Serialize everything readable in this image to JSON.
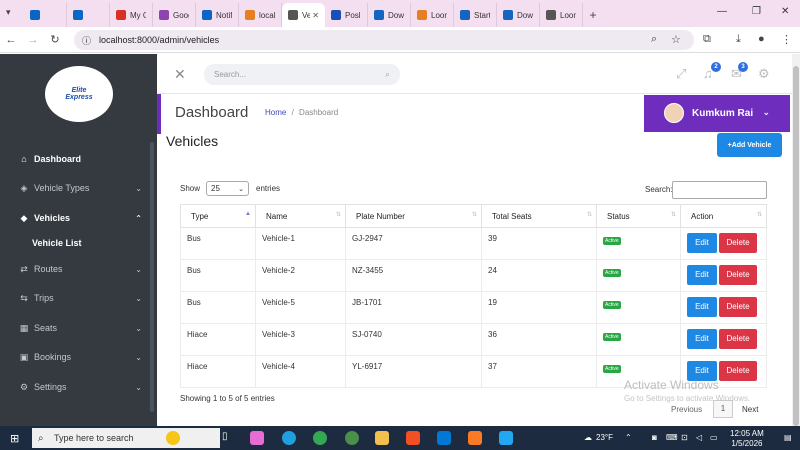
{
  "browser": {
    "tabs": [
      {
        "label": "",
        "color": "#0a66c2"
      },
      {
        "label": "",
        "color": "#0a66c2"
      },
      {
        "label": "My Ch",
        "color": "#d93025"
      },
      {
        "label": "Googl",
        "color": "#8e44ad"
      },
      {
        "label": "Notifi",
        "color": "#0a66c2"
      },
      {
        "label": "localh",
        "color": "#e67e22"
      },
      {
        "label": "Ve",
        "color": "#555555",
        "active": true
      },
      {
        "label": "Posla",
        "color": "#1a4fb5"
      },
      {
        "label": "Down",
        "color": "#1565c0"
      },
      {
        "label": "Loom",
        "color": "#e67e22"
      },
      {
        "label": "Start U",
        "color": "#1565c0"
      },
      {
        "label": "Down",
        "color": "#1565c0"
      },
      {
        "label": "Loom",
        "color": "#555555"
      }
    ],
    "url": "localhost:8000/admin/vehicles"
  },
  "sidebar": {
    "logo": {
      "line1": "Elite",
      "line2": "Express"
    },
    "items": [
      {
        "label": "Dashboard",
        "icon": "home-icon"
      },
      {
        "label": "Vehicle Types",
        "icon": "tag-icon"
      },
      {
        "label": "Vehicles",
        "icon": "tags-icon"
      },
      {
        "label": "Routes",
        "icon": "route-icon"
      },
      {
        "label": "Trips",
        "icon": "trip-icon"
      },
      {
        "label": "Seats",
        "icon": "grid-icon"
      },
      {
        "label": "Bookings",
        "icon": "booking-icon"
      },
      {
        "label": "Settings",
        "icon": "gear-icon"
      }
    ],
    "subitem": "Vehicle List"
  },
  "header": {
    "search_placeholder": "Search...",
    "notifications_count": "2",
    "messages_count": "3"
  },
  "pagehead": {
    "title": "Dashboard",
    "crumb_home": "Home",
    "crumb_sep": "/",
    "crumb_current": "Dashboard"
  },
  "user": {
    "name": "Kumkum Rai"
  },
  "content": {
    "title": "Vehicles",
    "add_button": "+Add Vehicle",
    "show_label": "Show",
    "page_size": "25",
    "entries_label": "entries",
    "search_label": "Search:",
    "columns": [
      "Type",
      "Name",
      "Plate Number",
      "Total Seats",
      "Status",
      "Action"
    ],
    "rows": [
      {
        "type": "Bus",
        "name": "Vehicle-1",
        "plate": "GJ-2947",
        "seats": "39",
        "status": "Active"
      },
      {
        "type": "Bus",
        "name": "Vehicle-2",
        "plate": "NZ-3455",
        "seats": "24",
        "status": "Active"
      },
      {
        "type": "Bus",
        "name": "Vehicle-5",
        "plate": "JB-1701",
        "seats": "19",
        "status": "Active"
      },
      {
        "type": "Hiace",
        "name": "Vehicle-3",
        "plate": "SJ-0740",
        "seats": "36",
        "status": "Active"
      },
      {
        "type": "Hiace",
        "name": "Vehicle-4",
        "plate": "YL-6917",
        "seats": "37",
        "status": "Active"
      }
    ],
    "edit_label": "Edit",
    "delete_label": "Delete",
    "info": "Showing 1 to 5 of 5 entries",
    "prev": "Previous",
    "page": "1",
    "next": "Next"
  },
  "watermark": {
    "line1": "Activate Windows",
    "line2": "Go to Settings to activate Windows."
  },
  "taskbar": {
    "search_placeholder": "Type here to search",
    "weather": "23°F",
    "time": "12:05 AM",
    "date": "1/5/2026"
  },
  "colors": {
    "accent": "#6f2dbd",
    "primary": "#1e88e5",
    "danger": "#dc3545",
    "success": "#28a745",
    "sidebar": "#343a40"
  }
}
